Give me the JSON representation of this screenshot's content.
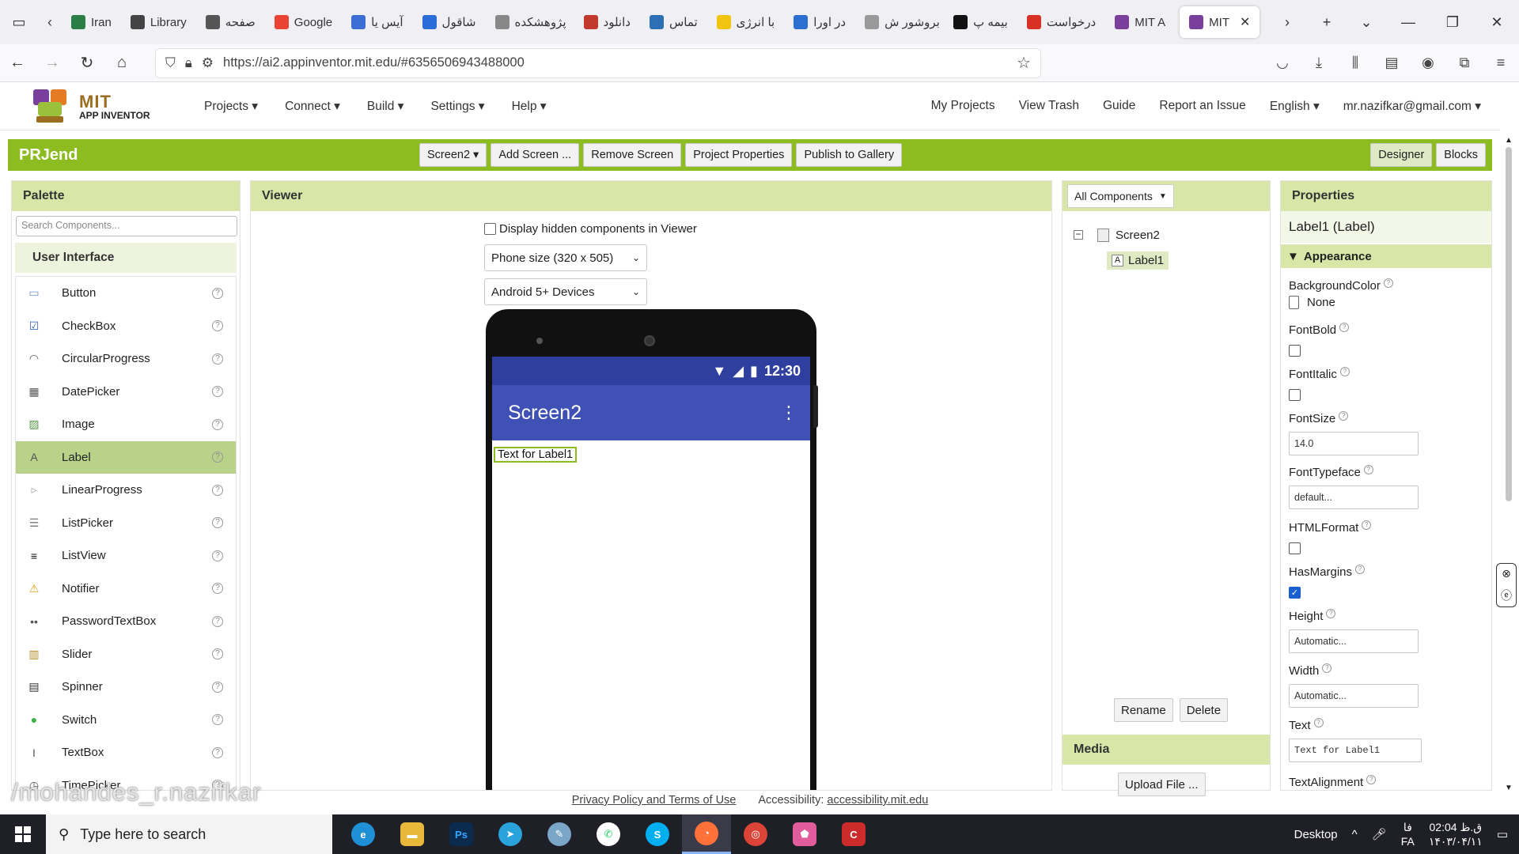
{
  "browser": {
    "tabs": [
      {
        "title": "Iran",
        "color": "#2d7d46"
      },
      {
        "title": "Library",
        "color": "#444444"
      },
      {
        "title": "صفحه",
        "color": "#555555"
      },
      {
        "title": "Google",
        "color": "#ea4335"
      },
      {
        "title": "آیس یا",
        "color": "#3b6fd6"
      },
      {
        "title": "شاقول",
        "color": "#2a6dd9"
      },
      {
        "title": "پژوهشکده",
        "color": "#888888"
      },
      {
        "title": "دانلود",
        "color": "#c0392b"
      },
      {
        "title": "تماس",
        "color": "#2d6fb5"
      },
      {
        "title": "با انرژی",
        "color": "#f1c40f"
      },
      {
        "title": "در اورا",
        "color": "#2c6fd1"
      },
      {
        "title": "بروشور ش",
        "color": "#999999"
      },
      {
        "title": "بیمه پ",
        "color": "#111111"
      },
      {
        "title": "درخواست",
        "color": "#d93025"
      },
      {
        "title": "MIT A",
        "color": "#7a3e9d"
      }
    ],
    "active_tab": {
      "title": "MIT",
      "color": "#7a3e9d"
    },
    "url": "https://ai2.appinventor.mit.edu/#6356506943488000"
  },
  "app": {
    "logo_title": "MIT",
    "logo_sub": "APP INVENTOR",
    "menu": [
      "Projects ▾",
      "Connect ▾",
      "Build ▾",
      "Settings ▾",
      "Help ▾"
    ],
    "right_menu": [
      "My Projects",
      "View Trash",
      "Guide",
      "Report an Issue",
      "English ▾",
      "mr.nazifkar@gmail.com ▾"
    ]
  },
  "project": {
    "name": "PRJend",
    "screen_select": "Screen2 ▾",
    "buttons": [
      "Add Screen ...",
      "Remove Screen",
      "Project Properties",
      "Publish to Gallery"
    ],
    "designer": "Designer",
    "blocks": "Blocks"
  },
  "palette": {
    "title": "Palette",
    "search_placeholder": "Search Components...",
    "section": "User Interface",
    "items": [
      {
        "label": "Button",
        "icon": "button-icon"
      },
      {
        "label": "CheckBox",
        "icon": "checkbox-icon"
      },
      {
        "label": "CircularProgress",
        "icon": "circular-progress-icon"
      },
      {
        "label": "DatePicker",
        "icon": "datepicker-icon"
      },
      {
        "label": "Image",
        "icon": "image-icon"
      },
      {
        "label": "Label",
        "icon": "label-icon"
      },
      {
        "label": "LinearProgress",
        "icon": "linear-progress-icon"
      },
      {
        "label": "ListPicker",
        "icon": "listpicker-icon"
      },
      {
        "label": "ListView",
        "icon": "listview-icon"
      },
      {
        "label": "Notifier",
        "icon": "notifier-icon"
      },
      {
        "label": "PasswordTextBox",
        "icon": "password-icon"
      },
      {
        "label": "Slider",
        "icon": "slider-icon"
      },
      {
        "label": "Spinner",
        "icon": "spinner-icon"
      },
      {
        "label": "Switch",
        "icon": "switch-icon"
      },
      {
        "label": "TextBox",
        "icon": "textbox-icon"
      },
      {
        "label": "TimePicker",
        "icon": "timepicker-icon"
      }
    ],
    "help": "?"
  },
  "viewer": {
    "title": "Viewer",
    "hidden_checkbox": "Display hidden components in Viewer",
    "phone_size": "Phone size (320 x 505)",
    "devices": "Android 5+ Devices",
    "time": "12:30",
    "screen_title": "Screen2",
    "label_text": "Text for Label1"
  },
  "components": {
    "dropdown": "All Components",
    "tree": [
      "Screen2",
      "Label1"
    ],
    "rename": "Rename",
    "delete": "Delete",
    "media_title": "Media",
    "upload": "Upload File ..."
  },
  "properties": {
    "title": "Properties",
    "component": "Label1 (Label)",
    "group": "Appearance",
    "background_label": "BackgroundColor",
    "background_value": "None",
    "fontbold_label": "FontBold",
    "fontitalic_label": "FontItalic",
    "fontsize_label": "FontSize",
    "fontsize_value": "14.0",
    "fonttypeface_label": "FontTypeface",
    "fonttypeface_value": "default...",
    "htmlformat_label": "HTMLFormat",
    "hasmargins_label": "HasMargins",
    "height_label": "Height",
    "height_value": "Automatic...",
    "width_label": "Width",
    "width_value": "Automatic...",
    "text_label": "Text",
    "text_value": "Text for Label1",
    "textalign_label": "TextAlignment"
  },
  "footer": {
    "privacy": "Privacy Policy and Terms of Use",
    "access_label": "Accessibility:",
    "access_link": "accessibility.mit.edu"
  },
  "watermark": "/mohandes_r.nazifkar",
  "taskbar": {
    "search": "Type here to search",
    "desktop": "Desktop",
    "lang1": "فا",
    "lang2": "FA",
    "time": "02:04 ق.ظ",
    "date": "۱۴۰۳/۰۴/۱۱"
  }
}
